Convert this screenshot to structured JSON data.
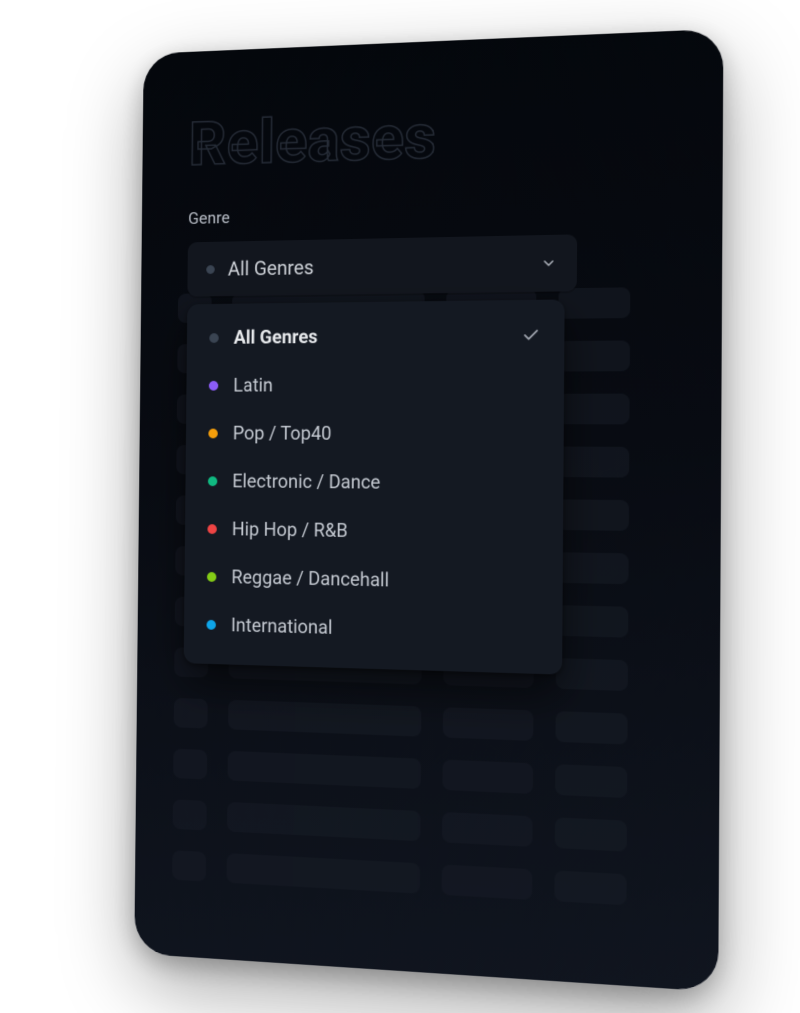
{
  "page": {
    "title": "Releases"
  },
  "filter": {
    "label": "Genre",
    "selected_label": "All Genres"
  },
  "genres": [
    {
      "label": "All Genres",
      "color": "#3a4452",
      "selected": true
    },
    {
      "label": "Latin",
      "color": "#8b5cf6",
      "selected": false
    },
    {
      "label": "Pop / Top40",
      "color": "#f59e0b",
      "selected": false
    },
    {
      "label": "Electronic / Dance",
      "color": "#10b981",
      "selected": false
    },
    {
      "label": "Hip Hop / R&B",
      "color": "#ef4444",
      "selected": false
    },
    {
      "label": "Reggae / Dancehall",
      "color": "#84cc16",
      "selected": false
    },
    {
      "label": "International",
      "color": "#0ea5e9",
      "selected": false
    }
  ]
}
